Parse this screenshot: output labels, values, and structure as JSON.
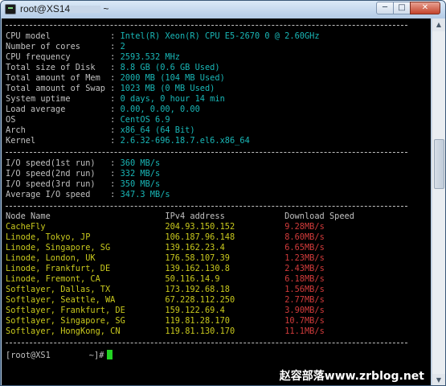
{
  "window": {
    "title_prefix": "root@XS14",
    "title_suffix": " ~",
    "btn_min": "─",
    "btn_max": "□",
    "btn_close": "✕"
  },
  "sys": [
    {
      "label": "CPU model            : ",
      "value": "Intel(R) Xeon(R) CPU E5-2670 0 @ 2.60GHz"
    },
    {
      "label": "Number of cores      : ",
      "value": "2"
    },
    {
      "label": "CPU frequency        : ",
      "value": "2593.532 MHz"
    },
    {
      "label": "Total size of Disk   : ",
      "value": "8.8 GB (0.6 GB Used)"
    },
    {
      "label": "Total amount of Mem  : ",
      "value": "2000 MB (104 MB Used)"
    },
    {
      "label": "Total amount of Swap : ",
      "value": "1023 MB (0 MB Used)"
    },
    {
      "label": "System uptime        : ",
      "value": "0 days, 0 hour 14 min"
    },
    {
      "label": "Load average         : ",
      "value": "0.00, 0.00, 0.00"
    },
    {
      "label": "OS                   : ",
      "value": "CentOS 6.9"
    },
    {
      "label": "Arch                 : ",
      "value": "x86_64 (64 Bit)"
    },
    {
      "label": "Kernel               : ",
      "value": "2.6.32-696.18.7.el6.x86_64"
    }
  ],
  "io": [
    {
      "label": "I/O speed(1st run)   : ",
      "value": "360 MB/s"
    },
    {
      "label": "I/O speed(2nd run)   : ",
      "value": "332 MB/s"
    },
    {
      "label": "I/O speed(3rd run)   : ",
      "value": "350 MB/s"
    },
    {
      "label": "Average I/O speed    : ",
      "value": "347.3 MB/s"
    }
  ],
  "table": {
    "header": "Node Name                       IPv4 address            Download Speed",
    "rows": [
      {
        "node": "CacheFly                        ",
        "ip": "204.93.150.152          ",
        "speed": "9.28MB/s"
      },
      {
        "node": "Linode, Tokyo, JP               ",
        "ip": "106.187.96.148          ",
        "speed": "8.60MB/s"
      },
      {
        "node": "Linode, Singapore, SG           ",
        "ip": "139.162.23.4            ",
        "speed": "6.65MB/s"
      },
      {
        "node": "Linode, London, UK              ",
        "ip": "176.58.107.39           ",
        "speed": "1.23MB/s"
      },
      {
        "node": "Linode, Frankfurt, DE           ",
        "ip": "139.162.130.8           ",
        "speed": "2.43MB/s"
      },
      {
        "node": "Linode, Fremont, CA             ",
        "ip": "50.116.14.9             ",
        "speed": "6.18MB/s"
      },
      {
        "node": "Softlayer, Dallas, TX           ",
        "ip": "173.192.68.18           ",
        "speed": "1.56MB/s"
      },
      {
        "node": "Softlayer, Seattle, WA          ",
        "ip": "67.228.112.250          ",
        "speed": "2.77MB/s"
      },
      {
        "node": "Softlayer, Frankfurt, DE        ",
        "ip": "159.122.69.4            ",
        "speed": "3.90MB/s"
      },
      {
        "node": "Softlayer, Singapore, SG        ",
        "ip": "119.81.28.170           ",
        "speed": "10.7MB/s"
      },
      {
        "node": "Softlayer, HongKong, CN         ",
        "ip": "119.81.130.170          ",
        "speed": "11.1MB/s"
      }
    ]
  },
  "prompt": {
    "prefix": "[root@XS1",
    "suffix": "~]#"
  },
  "watermark": "赵容部落www.zrblog.net",
  "scroll": {
    "up": "▲",
    "down": "▼"
  }
}
